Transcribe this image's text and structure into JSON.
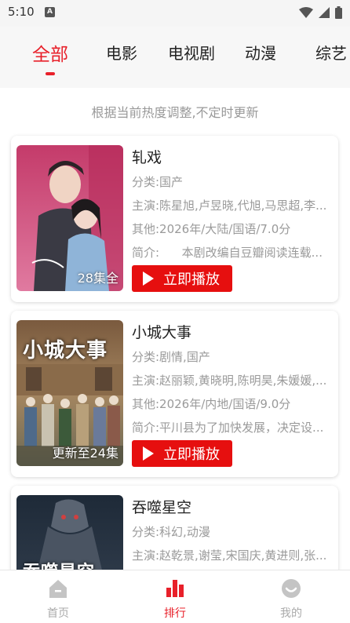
{
  "status_bar": {
    "time": "5:10",
    "notif_icon": "A"
  },
  "tabs": [
    {
      "label": "全部",
      "active": true
    },
    {
      "label": "电影",
      "active": false
    },
    {
      "label": "电视剧",
      "active": false
    },
    {
      "label": "动漫",
      "active": false
    },
    {
      "label": "综艺",
      "active": false
    }
  ],
  "notice": "根据当前热度调整,不定时更新",
  "movies": [
    {
      "title": "轧戏",
      "category": "分类:国产",
      "cast": "主演:陈星旭,卢昱晓,代旭,马思超,李...",
      "other": "其他:2026年/大陆/国语/7.0分",
      "synopsis": "简介:      本剧改编自豆瓣阅读连载...",
      "badge": "28集全",
      "play_label": "立即播放"
    },
    {
      "title": "小城大事",
      "category": "分类:剧情,国产",
      "cast": "主演:赵丽颖,黄晓明,陈明昊,朱媛媛,...",
      "other": "其他:2026年/内地/国语/9.0分",
      "synopsis": "简介:平川县为了加快发展，决定设...",
      "badge": "更新至24集",
      "poster_text": "小城大事",
      "play_label": "立即播放"
    },
    {
      "title": "吞噬星空",
      "category": "分类:科幻,动漫",
      "cast": "主演:赵乾景,谢莹,宋国庆,黄进则,张...",
      "poster_text": "吞噬星空"
    }
  ],
  "bottom_nav": [
    {
      "label": "首页",
      "icon": "home-icon",
      "active": false
    },
    {
      "label": "排行",
      "icon": "ranking-icon",
      "active": true
    },
    {
      "label": "我的",
      "icon": "profile-icon",
      "active": false
    }
  ],
  "colors": {
    "accent": "#e8202a",
    "play_button": "#e60f0f"
  }
}
